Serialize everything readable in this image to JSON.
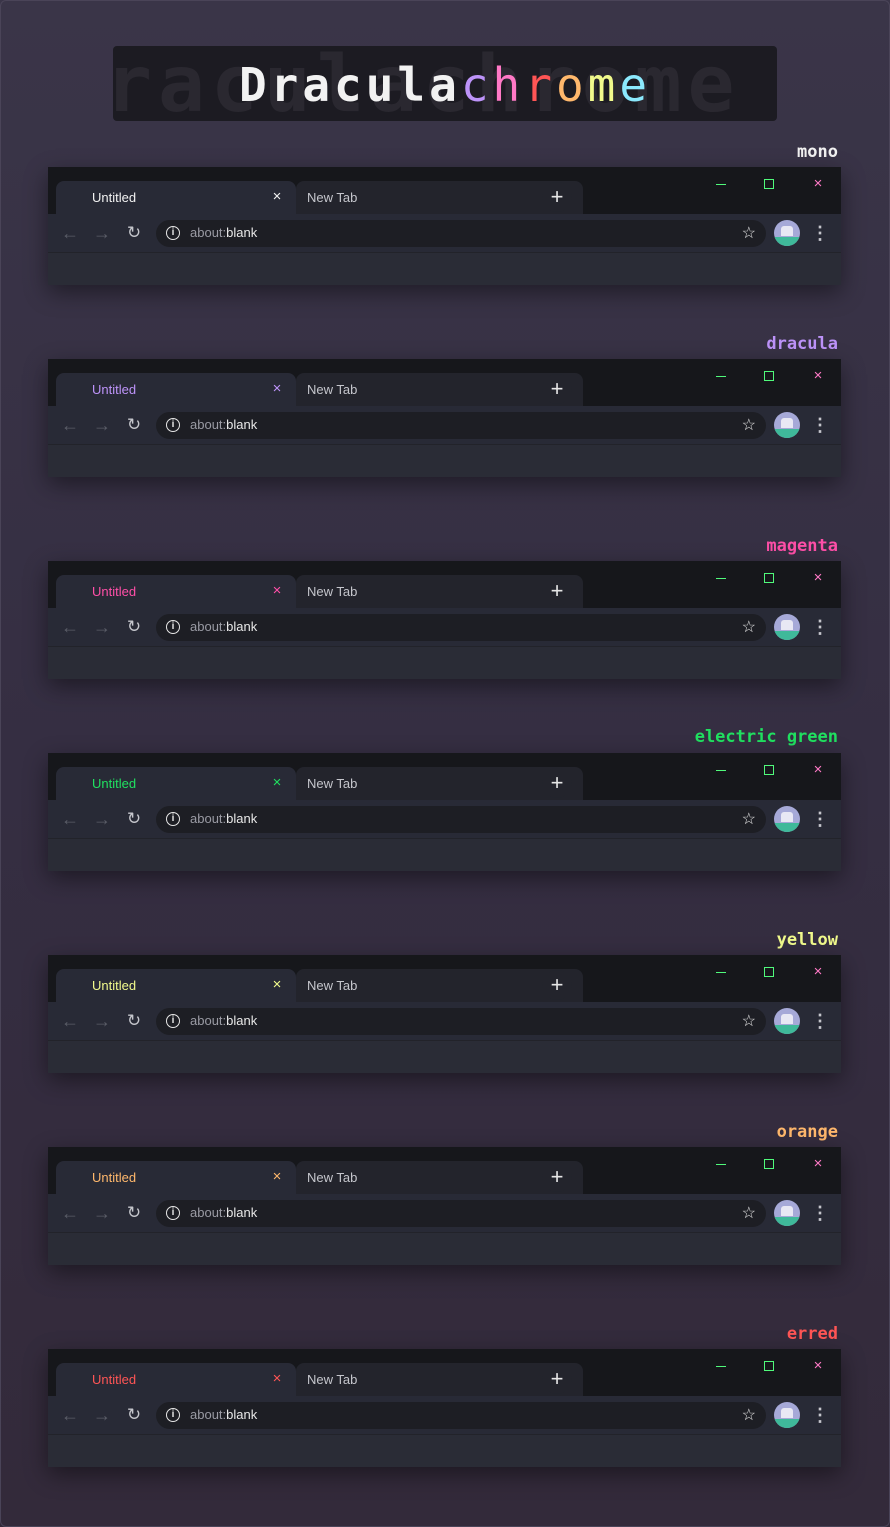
{
  "banner": {
    "ghost_text": "raculachrome",
    "title_part1": "Dracula",
    "title_part2_letters": [
      "c",
      "h",
      "r",
      "o",
      "m",
      "e"
    ],
    "title_part2_colors": [
      "#bd93f9",
      "#ff79c6",
      "#ff5555",
      "#ffb86c",
      "#f1fa8c",
      "#8be9fd"
    ]
  },
  "tabs": {
    "active_title": "Untitled",
    "inactive_title": "New Tab",
    "close_icon": "×",
    "new_tab_icon": "+"
  },
  "window_controls": {
    "minimize": "minimize-icon",
    "maximize": "maximize-icon",
    "close": "×"
  },
  "toolbar": {
    "back_icon": "←",
    "forward_icon": "→",
    "reload_icon": "↻",
    "info_icon": "i",
    "url_scheme": "about:",
    "url_host": "blank",
    "star_icon": "☆",
    "menu_icon": "⋮"
  },
  "variants": [
    {
      "name": "mono",
      "accent": "#f2f2f2"
    },
    {
      "name": "dracula",
      "accent": "#bd93f9"
    },
    {
      "name": "magenta",
      "accent": "#ff4fa8"
    },
    {
      "name": "electric green",
      "accent": "#20e060"
    },
    {
      "name": "yellow",
      "accent": "#f1fa8c"
    },
    {
      "name": "orange",
      "accent": "#ffb86c"
    },
    {
      "name": "erred",
      "accent": "#ff5555"
    }
  ]
}
